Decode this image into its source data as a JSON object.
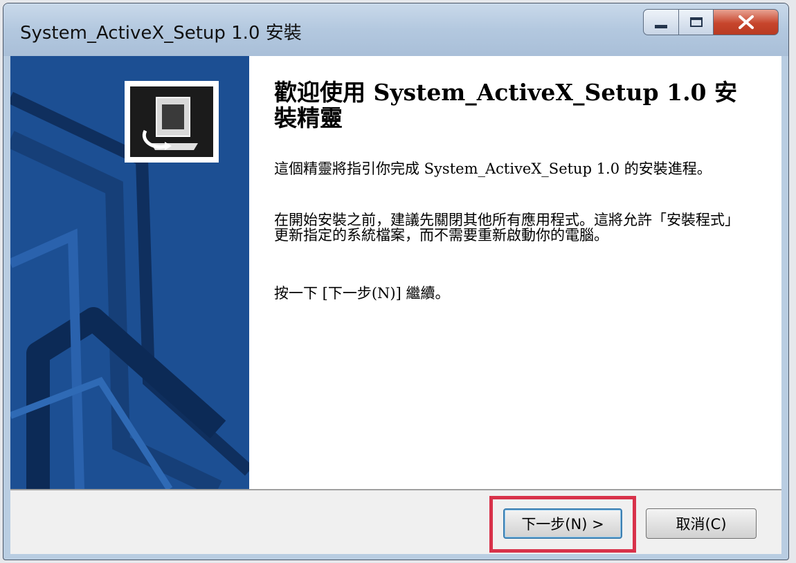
{
  "window": {
    "title": "System_ActiveX_Setup 1.0 安裝"
  },
  "content": {
    "heading": "歡迎使用 System_ActiveX_Setup 1.0 安裝精靈",
    "paragraph1": "這個精靈將指引你完成 System_ActiveX_Setup 1.0 的安裝進程。",
    "paragraph2": "在開始安裝之前，建議先關閉其他所有應用程式。這將允許「安裝程式」更新指定的系統檔案，而不需要重新啟動你的電腦。",
    "paragraph3": "按一下 [下一步(N)] 繼續。"
  },
  "buttons": {
    "next_label": "下一步(N) >",
    "cancel_label": "取消(C)"
  },
  "colors": {
    "banner": "#1c4f93",
    "highlight": "#d8324a"
  },
  "icons": {
    "installer": "installer-computer-icon",
    "minimize": "minimize-icon",
    "maximize": "maximize-icon",
    "close": "close-icon"
  }
}
